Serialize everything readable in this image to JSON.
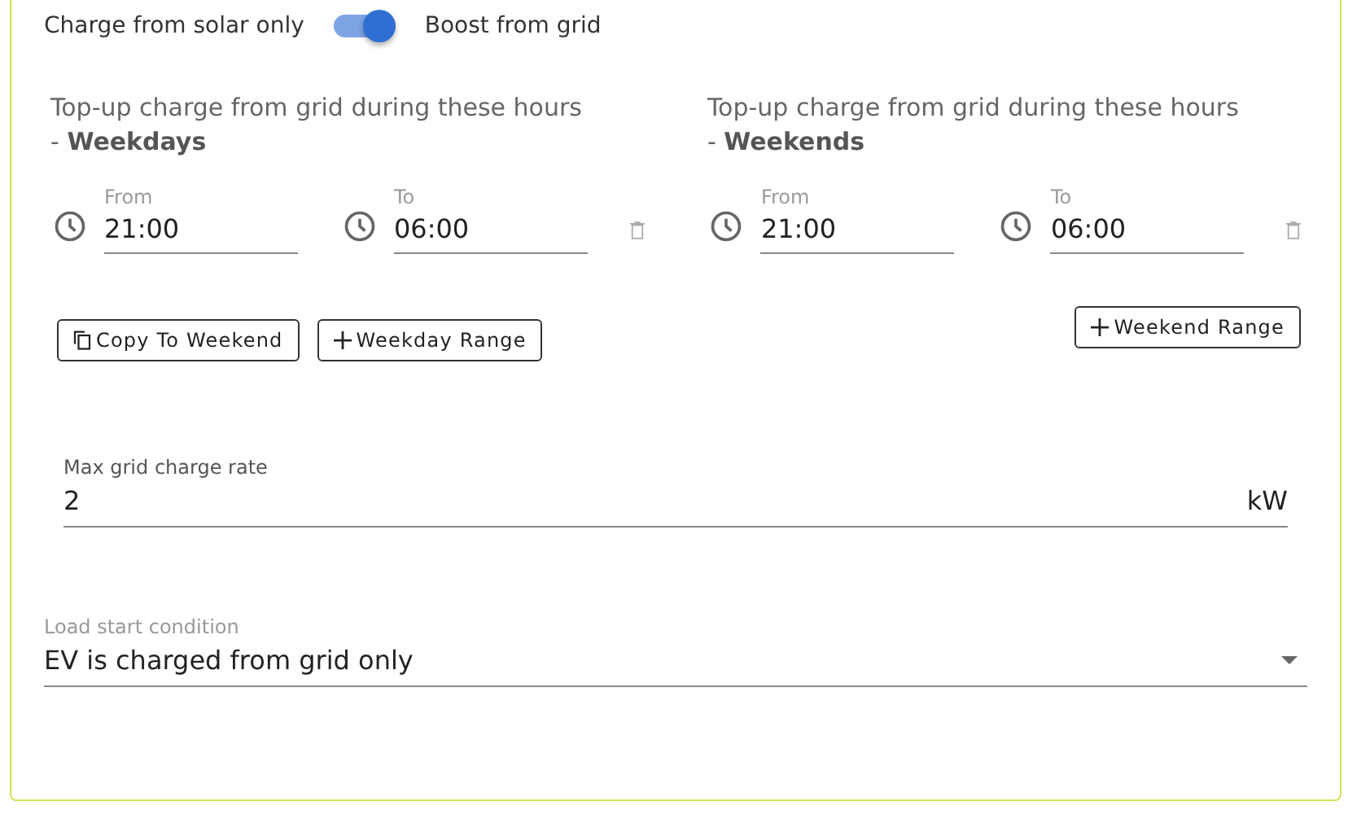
{
  "toggle": {
    "left_label": "Charge from solar only",
    "right_label": "Boost from grid",
    "on": true
  },
  "schedules": [
    {
      "title": "Top-up charge from grid during these hours\n- **Weekdays**",
      "ranges": [
        {
          "from_label": "From",
          "from": "21:00",
          "to_label": "To",
          "to": "06:00"
        }
      ],
      "buttons": [
        {
          "kind": "copy",
          "label": "Copy To Weekend"
        },
        {
          "kind": "add",
          "label": "Weekday Range"
        }
      ]
    },
    {
      "title": "Top-up charge from grid during these hours\n- **Weekends**",
      "ranges": [
        {
          "from_label": "From",
          "from": "21:00",
          "to_label": "To",
          "to": "06:00"
        }
      ],
      "buttons": [
        {
          "kind": "add",
          "label": "Weekend Range"
        }
      ]
    }
  ],
  "rate": {
    "label": "Max grid charge rate",
    "value": "2",
    "unit": "kW"
  },
  "load": {
    "label": "Load start condition",
    "value": "EV is charged from grid only"
  }
}
